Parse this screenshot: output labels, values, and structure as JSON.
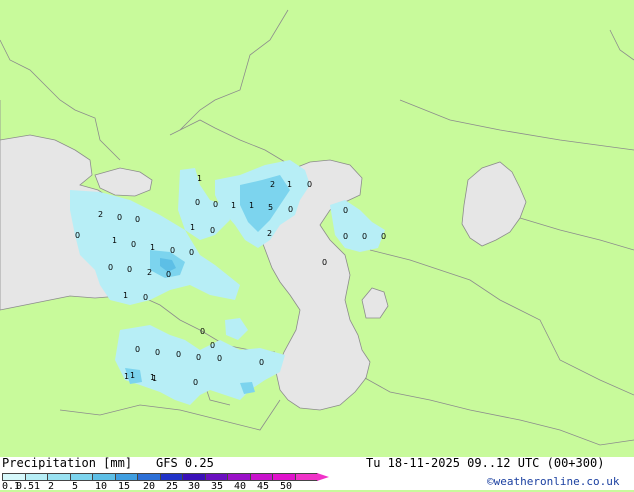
{
  "footer": {
    "title": "Precipitation [mm]",
    "model": "GFS 0.25",
    "valid_time": "Tu 18-11-2025 09..12 UTC (00+300)",
    "credit": "©weatheronline.co.uk"
  },
  "legend": {
    "labels": [
      "0.1",
      "0.5",
      "1",
      "2",
      "5",
      "10",
      "15",
      "20",
      "25",
      "30",
      "35",
      "40",
      "45",
      "50"
    ],
    "colors": [
      "#d6f8fb",
      "#b7eef6",
      "#9ae2f2",
      "#7cd4ee",
      "#5dbfe6",
      "#3f9ee0",
      "#2c6fd6",
      "#2032c8",
      "#3a10b8",
      "#6a0fc0",
      "#9a10c8",
      "#c812cc",
      "#e012cc",
      "#f032c8"
    ]
  },
  "colors": {
    "land": "#c8fa9b",
    "sea": "#e6e6e6",
    "rain_light": "#b7eef6",
    "rain_moderate": "#7cd4ee",
    "border": "#8c8c8c"
  },
  "map_values": [
    {
      "text": "1"
    },
    {
      "text": "2"
    },
    {
      "text": "1"
    },
    {
      "text": "0"
    },
    {
      "text": "0"
    },
    {
      "text": "0"
    },
    {
      "text": "1"
    },
    {
      "text": "1"
    },
    {
      "text": "5"
    },
    {
      "text": "0"
    },
    {
      "text": "1"
    },
    {
      "text": "0"
    },
    {
      "text": "0"
    },
    {
      "text": "2"
    },
    {
      "text": "0"
    },
    {
      "text": "0"
    },
    {
      "text": "0"
    },
    {
      "text": "0"
    },
    {
      "text": "2"
    },
    {
      "text": "0"
    },
    {
      "text": "0"
    },
    {
      "text": "0"
    },
    {
      "text": "1"
    },
    {
      "text": "0"
    },
    {
      "text": "1"
    },
    {
      "text": "0"
    },
    {
      "text": "0"
    },
    {
      "text": "0"
    },
    {
      "text": "0"
    },
    {
      "text": "2"
    },
    {
      "text": "0"
    },
    {
      "text": "1"
    },
    {
      "text": "0"
    },
    {
      "text": "0"
    },
    {
      "text": "0"
    },
    {
      "text": "0"
    },
    {
      "text": "0"
    },
    {
      "text": "0"
    },
    {
      "text": "0"
    },
    {
      "text": "0"
    },
    {
      "text": "1"
    },
    {
      "text": "1"
    },
    {
      "text": "1"
    },
    {
      "text": "0"
    },
    {
      "text": "1"
    },
    {
      "text": "0"
    }
  ]
}
